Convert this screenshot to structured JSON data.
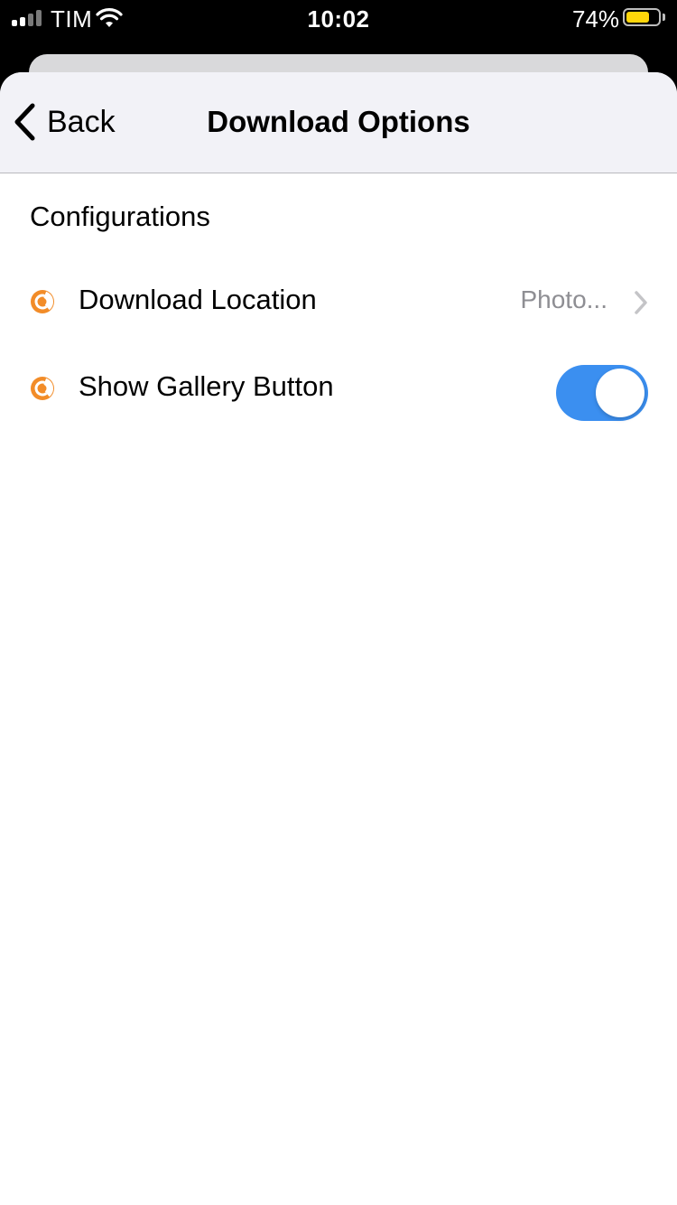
{
  "status_bar": {
    "carrier": "TIM",
    "time": "10:02",
    "battery_percent": "74%",
    "battery_level": 0.74,
    "battery_color": "#ffd60a",
    "signal_bars_filled": 2,
    "signal_bars_total": 4
  },
  "nav": {
    "back_label": "Back",
    "title": "Download Options"
  },
  "section": {
    "header": "Configurations"
  },
  "settings": {
    "download_location": {
      "label": "Download Location",
      "value": "Photo...",
      "icon": "app-logo-icon"
    },
    "show_gallery_button": {
      "label": "Show Gallery Button",
      "enabled": true,
      "icon": "app-logo-icon"
    }
  },
  "colors": {
    "accent": "#f28c28",
    "toggle_on": "#3b8ff0",
    "nav_background": "#f2f2f7",
    "secondary_text": "#8e8e93"
  }
}
